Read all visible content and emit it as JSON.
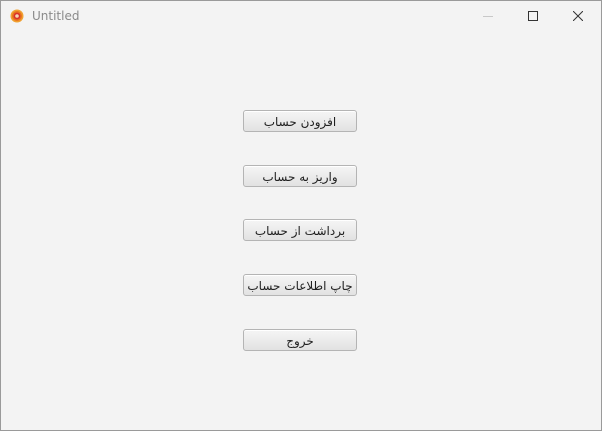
{
  "window": {
    "title": "Untitled",
    "app_icon": "app-logo-icon",
    "controls": {
      "minimize_icon": "minimize-icon",
      "maximize_icon": "maximize-icon",
      "close_icon": "close-icon"
    }
  },
  "menu": {
    "add_account": "افزودن حساب",
    "deposit": "واریز به حساب",
    "withdraw": "برداشت از حساب",
    "print_info": "چاپ اطلاعات حساب",
    "exit": "خروج"
  },
  "colors": {
    "window_background": "#f3f3f3",
    "button_border": "#b4b4b4",
    "button_text": "#1e1e1e",
    "app_icon_outer": "#e8731e",
    "app_icon_inner": "#d9302b"
  }
}
